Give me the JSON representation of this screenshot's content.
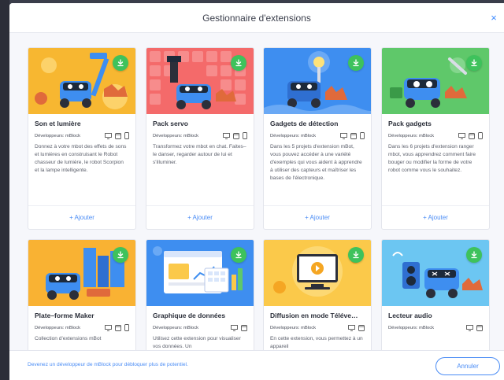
{
  "dialog": {
    "title": "Gestionnaire d'extensions",
    "close_label": "×"
  },
  "cards": [
    {
      "title": "Son et lumière",
      "developer": "Développeurs: mBlock",
      "description": "Donnez à votre mbot des effets de sons et lumières en construisant le Robot chasseur de lumière, le robot Scorpion et la lampe intelligente.",
      "add_label": "+ Ajouter",
      "thumb_color": "#f7b731",
      "platforms": [
        "computer-icon",
        "tablet-icon",
        "phone-icon"
      ]
    },
    {
      "title": "Pack servo",
      "developer": "Développeurs: mBlock",
      "description": "Transformez votre mbot en chat. Faites–le danser, regarder autour de lui et s'illuminer.",
      "add_label": "+ Ajouter",
      "thumb_color": "#f46a6a",
      "platforms": [
        "computer-icon",
        "tablet-icon",
        "phone-icon"
      ]
    },
    {
      "title": "Gadgets de détection",
      "developer": "Développeurs: mBlock",
      "description": "Dans les 5 projets d'extension mBot, vous pouvez accéder à une variété d'exemples qui vous aident à apprendre à utiliser des capteurs et maîtriser les bases de l'électronique.",
      "add_label": "+ Ajouter",
      "thumb_color": "#3e8ef0",
      "platforms": [
        "computer-icon",
        "tablet-icon",
        "phone-icon"
      ]
    },
    {
      "title": "Pack gadgets",
      "developer": "Développeurs: mBlock",
      "description": "Dans les 6 projets d'extension ranger mbot, vous apprendrez comment faire bouger ou modifier la forme de votre robot comme vous le souhaitez.",
      "add_label": "+ Ajouter",
      "thumb_color": "#5fc86a",
      "platforms": [
        "computer-icon",
        "tablet-icon",
        "phone-icon"
      ]
    },
    {
      "title": "Plate–forme Maker",
      "developer": "Développeurs: mBlock",
      "description": "Collection d'extensions mBot",
      "thumb_color": "#f9b233",
      "platforms": [
        "computer-icon",
        "tablet-icon",
        "phone-icon"
      ]
    },
    {
      "title": "Graphique de données",
      "developer": "Développeurs: mBlock",
      "description": "Utilisez cette extension pour visualiser vos données. Un",
      "thumb_color": "#3e8ef0",
      "platforms": [
        "computer-icon",
        "tablet-icon"
      ]
    },
    {
      "title": "Diffusion en mode Téléve…",
      "developer": "Développeurs: mBlock",
      "description": "En cette extension, vous permettez à un appareil",
      "thumb_color": "#fbc94a",
      "platforms": [
        "computer-icon",
        "tablet-icon"
      ]
    },
    {
      "title": "Lecteur audio",
      "developer": "Développeurs: mBlock",
      "description": "",
      "thumb_color": "#6cc6f2",
      "platforms": [
        "computer-icon",
        "tablet-icon"
      ]
    }
  ],
  "footer": {
    "link_text": "Devenez un développeur de mBlock pour débloquer plus de potentiel.",
    "cancel_label": "Annuler"
  },
  "colors": {
    "accent": "#4a8cf5",
    "download": "#3ec25c"
  }
}
